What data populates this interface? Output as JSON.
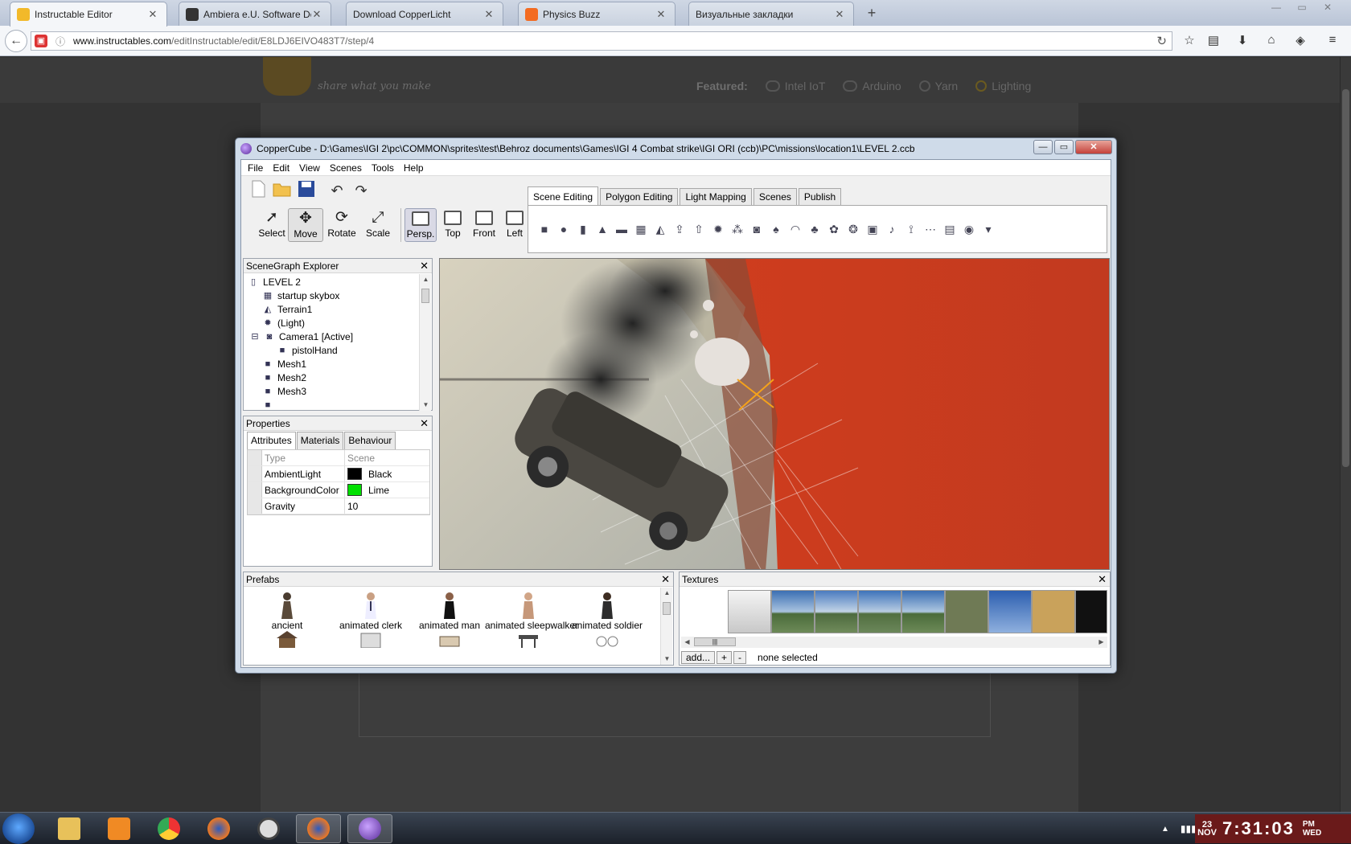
{
  "browser": {
    "tabs": [
      {
        "title": "Instructable Editor",
        "active": true,
        "favicon_color": "#f2b92a"
      },
      {
        "title": "Ambiera e.U. Software Dev...",
        "active": false,
        "favicon_color": "#333333"
      },
      {
        "title": "Download CopperLicht",
        "active": false,
        "favicon_color": ""
      },
      {
        "title": "Physics Buzz",
        "active": false,
        "favicon_color": "#f36b21"
      },
      {
        "title": "Визуальные закладки",
        "active": false,
        "favicon_color": ""
      }
    ],
    "url_host": "www.instructables.com",
    "url_path": "/editInstructable/edit/E8LDJ6EIVO483T7/step/4",
    "icons": [
      "back-icon",
      "site-icon",
      "info-icon",
      "reload-icon",
      "star-icon",
      "reading-list-icon",
      "download-icon",
      "home-icon",
      "pocket-icon",
      "menu-icon"
    ]
  },
  "page": {
    "tagline": "share what you make",
    "featured_label": "Featured:",
    "featured": [
      "Intel IoT",
      "Arduino",
      "Yarn",
      "Lighting"
    ]
  },
  "app": {
    "title": "CopperCube - D:\\Games\\IGI 2\\pc\\COMMON\\sprites\\test\\Behroz documents\\Games\\IGI 4 Combat strike\\IGI ORI (ccb)\\PC\\missions\\location1\\LEVEL 2.ccb",
    "menu": [
      "File",
      "Edit",
      "View",
      "Scenes",
      "Tools",
      "Help"
    ],
    "tools": [
      {
        "label": "Select",
        "active": false
      },
      {
        "label": "Move",
        "active": true
      },
      {
        "label": "Rotate",
        "active": false
      },
      {
        "label": "Scale",
        "active": false
      }
    ],
    "views": [
      {
        "label": "Persp.",
        "active": true
      },
      {
        "label": "Top",
        "active": false
      },
      {
        "label": "Front",
        "active": false
      },
      {
        "label": "Left",
        "active": false
      }
    ],
    "ribbon_tabs": [
      {
        "label": "Scene Editing",
        "active": true
      },
      {
        "label": "Polygon Editing",
        "active": false
      },
      {
        "label": "Light Mapping",
        "active": false
      },
      {
        "label": "Scenes",
        "active": false
      },
      {
        "label": "Publish",
        "active": false
      }
    ],
    "ribbon_icons": [
      "cube-icon",
      "sphere-icon",
      "cylinder-icon",
      "cone-icon",
      "plane-icon",
      "skybox-icon",
      "terrain-icon",
      "import-icon",
      "import-animated-icon",
      "light-icon",
      "particles-icon",
      "camera-icon",
      "billboard-icon",
      "water-icon",
      "tree-icon",
      "plant-icon",
      "path-icon",
      "video-icon",
      "sound-icon",
      "path-node-icon",
      "path-edit-icon",
      "text-3d-icon",
      "sphere-ball-icon",
      "more-dropdown-icon"
    ],
    "scenegraph": {
      "title": "SceneGraph Explorer",
      "nodes": [
        {
          "label": "LEVEL 2",
          "icon": "document-icon",
          "level": 0
        },
        {
          "label": "startup skybox",
          "icon": "skybox-icon",
          "level": 1
        },
        {
          "label": "Terrain1",
          "icon": "terrain-icon",
          "level": 1
        },
        {
          "label": "(Light)",
          "icon": "light-icon",
          "level": 1
        },
        {
          "label": "Camera1 [Active]",
          "icon": "camera-icon",
          "level": 1
        },
        {
          "label": "pistolHand",
          "icon": "mesh-icon",
          "level": 2
        },
        {
          "label": "Mesh1",
          "icon": "mesh-icon",
          "level": 1
        },
        {
          "label": "Mesh2",
          "icon": "mesh-icon",
          "level": 1
        },
        {
          "label": "Mesh3",
          "icon": "mesh-icon",
          "level": 1
        }
      ]
    },
    "properties": {
      "title": "Properties",
      "tabs": [
        {
          "label": "Attributes",
          "active": true
        },
        {
          "label": "Materials",
          "active": false
        },
        {
          "label": "Behaviour",
          "active": false
        }
      ],
      "header": {
        "key": "Type",
        "value": "Scene"
      },
      "rows": [
        {
          "key": "AmbientLight",
          "value": "Black",
          "color": "#000000"
        },
        {
          "key": "BackgroundColor",
          "value": "Lime",
          "color": "#00e000"
        },
        {
          "key": "Gravity",
          "value": "10",
          "color": ""
        }
      ]
    },
    "prefabs": {
      "title": "Prefabs",
      "items": [
        "ancient",
        "animated clerk",
        "animated man",
        "animated sleepwalker",
        "animated soldier"
      ]
    },
    "textures": {
      "title": "Textures",
      "add_label": "add...",
      "plus_label": "+",
      "minus_label": "-",
      "status": "none selected"
    }
  },
  "taskbar": {
    "apps": [
      "explorer",
      "media player",
      "chrome",
      "firefox-old",
      "clock",
      "firefox",
      "coppercube"
    ],
    "clock": {
      "day": "23",
      "month": "NOV",
      "time": "7:31:03",
      "ampm": "PM",
      "weekday": "WED"
    }
  }
}
